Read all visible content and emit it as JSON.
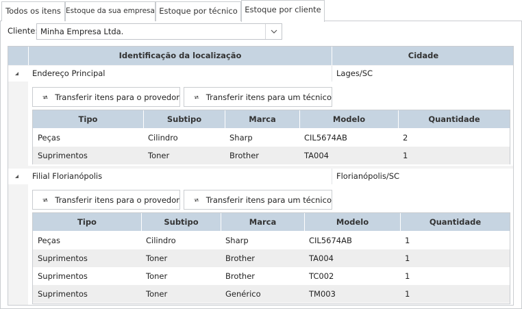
{
  "tabs": [
    {
      "label": "Todos os itens"
    },
    {
      "label": "Estoque da sua empresa"
    },
    {
      "label": "Estoque por técnico"
    },
    {
      "label": "Estoque por cliente"
    }
  ],
  "client": {
    "label": "Cliente:",
    "value": "Minha Empresa Ltda."
  },
  "grid": {
    "headers": [
      "Identificação da localização",
      "Cidade"
    ],
    "groups": [
      {
        "location": "Endereço Principal",
        "city": "Lages/SC",
        "actions": [
          "Transferir itens para o provedor",
          "Transferir itens para um técnico"
        ],
        "sub_headers": [
          "Tipo",
          "Subtipo",
          "Marca",
          "Modelo",
          "Quantidade"
        ],
        "rows": [
          [
            "Peças",
            "Cilindro",
            "Sharp",
            "CIL5674AB",
            "2"
          ],
          [
            "Suprimentos",
            "Toner",
            "Brother",
            "TA004",
            "1"
          ]
        ]
      },
      {
        "location": "Filial Florianópolis",
        "city": "Florianópolis/SC",
        "actions": [
          "Transferir itens para o provedor",
          "Transferir itens para um técnico"
        ],
        "sub_headers": [
          "Tipo",
          "Subtipo",
          "Marca",
          "Modelo",
          "Quantidade"
        ],
        "rows": [
          [
            "Peças",
            "Cilindro",
            "Sharp",
            "CIL5674AB",
            "1"
          ],
          [
            "Suprimentos",
            "Toner",
            "Brother",
            "TA004",
            "1"
          ],
          [
            "Suprimentos",
            "Toner",
            "Brother",
            "TC002",
            "1"
          ],
          [
            "Suprimentos",
            "Toner",
            "Genérico",
            "TM003",
            "1"
          ]
        ]
      }
    ]
  },
  "icons": {
    "transfer": "transfer-arrows-icon",
    "dropdown": "chevron-down-icon",
    "expander": "collapse-triangle-icon"
  }
}
